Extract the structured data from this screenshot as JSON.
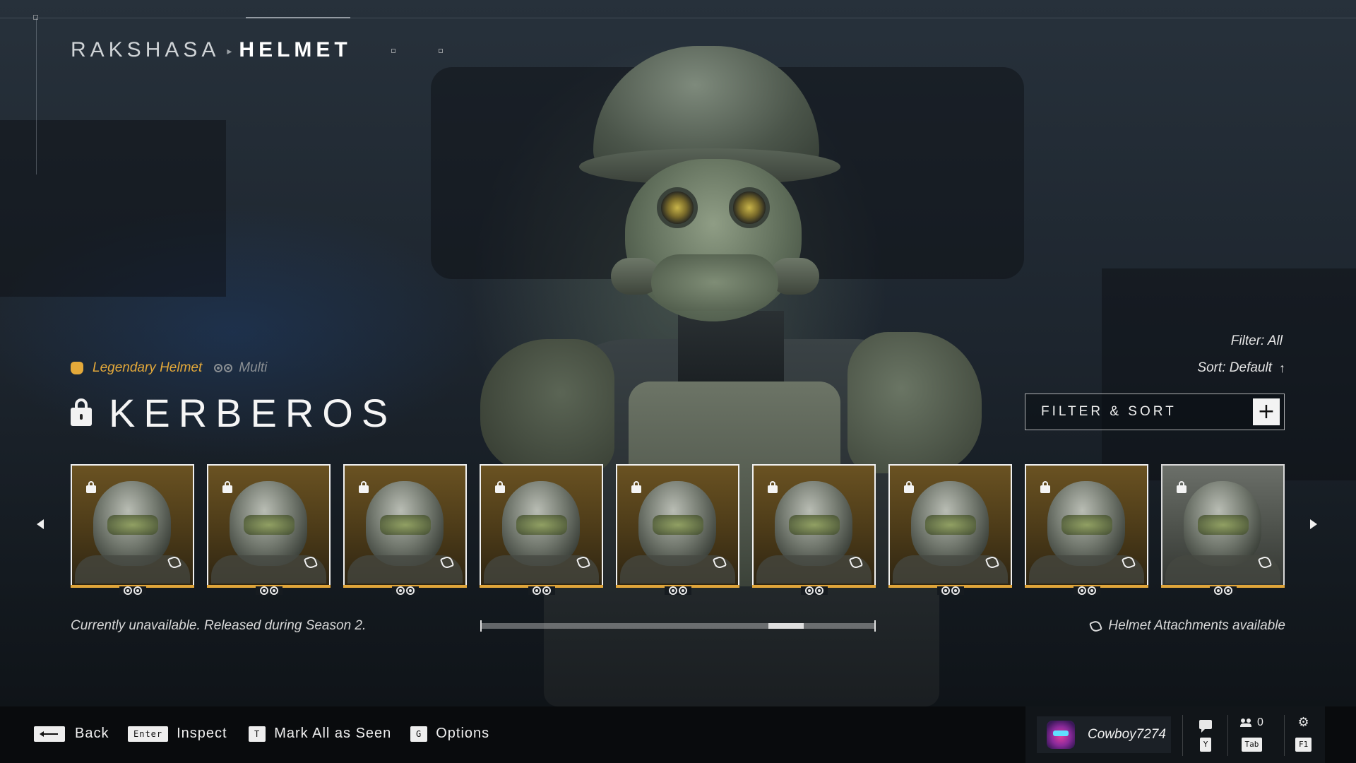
{
  "header": {
    "parent": "RAKSHASA",
    "current": "HELMET"
  },
  "item": {
    "rarity_label": "Legendary Helmet",
    "rarity_color": "#e4a93a",
    "mode_label": "Multi",
    "name": "KERBEROS",
    "locked": true,
    "status": "Currently unavailable. Released during Season 2.",
    "attachments_label": "Helmet Attachments available"
  },
  "filter": {
    "filter_label": "Filter: All",
    "sort_label": "Sort: Default",
    "button_label": "FILTER & SORT"
  },
  "carousel": {
    "items": [
      {
        "name": "helmet-card-1",
        "locked": true,
        "selected": false
      },
      {
        "name": "helmet-card-2",
        "locked": true,
        "selected": false
      },
      {
        "name": "helmet-card-3",
        "locked": true,
        "selected": false
      },
      {
        "name": "helmet-card-4",
        "locked": true,
        "selected": false
      },
      {
        "name": "helmet-card-5",
        "locked": true,
        "selected": false
      },
      {
        "name": "helmet-card-6",
        "locked": true,
        "selected": false
      },
      {
        "name": "helmet-card-7",
        "locked": true,
        "selected": false
      },
      {
        "name": "helmet-card-8",
        "locked": true,
        "selected": false
      },
      {
        "name": "helmet-card-9",
        "locked": true,
        "selected": true
      }
    ],
    "scroll_position": 0.8,
    "scroll_thumb_fraction": 0.09
  },
  "footer": {
    "hints": [
      {
        "key": "",
        "label": "Back"
      },
      {
        "key": "Enter",
        "label": "Inspect"
      },
      {
        "key": "T",
        "label": "Mark All as Seen"
      },
      {
        "key": "G",
        "label": "Options"
      }
    ],
    "gamertag": "Cowboy7274",
    "chat_key": "Y",
    "social_key": "Tab",
    "social_count": "0",
    "settings_key": "F1"
  }
}
